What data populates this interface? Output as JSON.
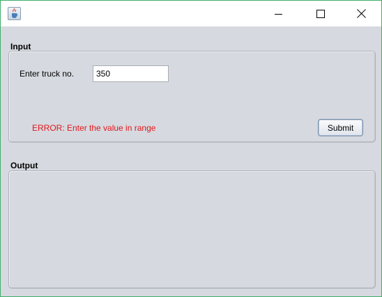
{
  "window": {
    "title": "",
    "app_icon": "java-cup-icon",
    "controls": [
      "minimize-icon",
      "maximize-icon",
      "close-icon"
    ]
  },
  "input_section": {
    "label": "Input",
    "truck_label": "Enter truck no.",
    "truck_value": "350",
    "error_message": "ERROR: Enter the value in range",
    "submit_label": "Submit"
  },
  "output_section": {
    "label": "Output"
  },
  "colors": {
    "error": "#e0161b",
    "window_border": "#3fae6a",
    "background": "#d6d9df"
  }
}
